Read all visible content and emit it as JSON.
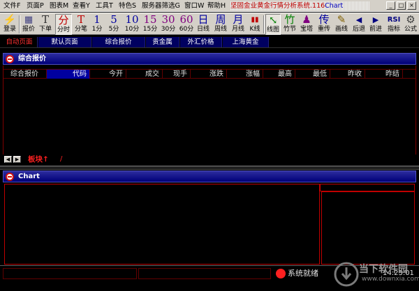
{
  "menubar": {
    "items": [
      "文件F",
      "页面P",
      "图表M",
      "查看Y",
      "工具T",
      "特色S",
      "服务器筛选G",
      "窗口W",
      "帮助H"
    ],
    "title": "坚固金业黄金行情分析系统.116",
    "title_ver": "Chart"
  },
  "window_buttons": {
    "minimize": "_",
    "restore": "□",
    "close": "×"
  },
  "toolbar": {
    "items": [
      {
        "icon": "⚡",
        "label": "登录"
      },
      {
        "icon": "▦",
        "label": "报价"
      },
      {
        "icon": "T",
        "label": "下单"
      },
      {
        "icon": "分",
        "label": "分时"
      },
      {
        "icon": "T",
        "label": "分笔"
      },
      {
        "icon": "1",
        "label": "1分"
      },
      {
        "icon": "5",
        "label": "5分"
      },
      {
        "icon": "10",
        "label": "10分"
      },
      {
        "icon": "15",
        "label": "15分"
      },
      {
        "icon": "30",
        "label": "30分"
      },
      {
        "icon": "60",
        "label": "60分"
      },
      {
        "icon": "日",
        "label": "日线"
      },
      {
        "icon": "周",
        "label": "周线"
      },
      {
        "icon": "月",
        "label": "月线"
      },
      {
        "icon": "▮▮",
        "label": "K线"
      },
      {
        "icon": "⤡",
        "label": "线图"
      },
      {
        "icon": "竹",
        "label": "竹节"
      },
      {
        "icon": "♟",
        "label": "宝塔"
      },
      {
        "icon": "传",
        "label": "重传"
      },
      {
        "icon": "✎",
        "label": "画线"
      },
      {
        "icon": "◀",
        "label": "后退"
      },
      {
        "icon": "▶",
        "label": "前进"
      },
      {
        "icon": "RSI",
        "label": "指标"
      },
      {
        "icon": "⚙",
        "label": "公式"
      }
    ]
  },
  "colors": {
    "accent": "#0000a0",
    "red": "#ff2020",
    "header_blue": "#000078"
  },
  "tabs": [
    "自动页面",
    "默认页面",
    "综合报价",
    "贵金属",
    "外汇价格",
    "上海黄金"
  ],
  "quote_panel": {
    "title": "综合报价",
    "columns": [
      "综合报价",
      "代码",
      "今开",
      "成交",
      "现手",
      "涨跌",
      "涨幅",
      "最高",
      "最低",
      "昨收",
      "昨结"
    ],
    "sector_label": "板块↑",
    "sector_slash": "/"
  },
  "chart_panel": {
    "title": "Chart"
  },
  "status": {
    "text": "系统就绪",
    "time": "14:23:01"
  },
  "watermark": {
    "text": "当下软件园",
    "url": "www.downxia.com"
  }
}
